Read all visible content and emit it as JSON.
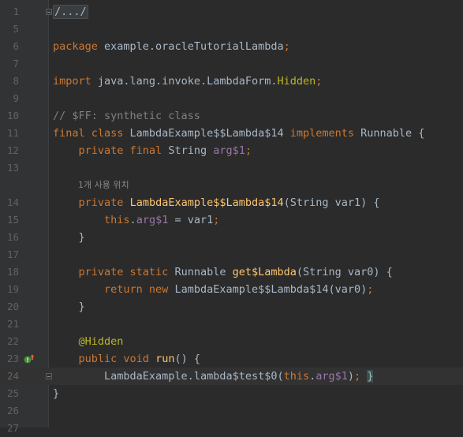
{
  "editor": {
    "lines": [
      {
        "n": "1",
        "tokens": [
          {
            "t": "/.../",
            "c": "folded-region"
          }
        ]
      },
      {
        "n": "5",
        "tokens": []
      },
      {
        "n": "6",
        "tokens": [
          {
            "t": "package",
            "c": "kw"
          },
          {
            "t": " example.oracleTutorialLambda",
            "c": ""
          },
          {
            "t": ";",
            "c": "kw"
          }
        ]
      },
      {
        "n": "7",
        "tokens": []
      },
      {
        "n": "8",
        "tokens": [
          {
            "t": "import",
            "c": "kw"
          },
          {
            "t": " java.lang.invoke.LambdaForm.",
            "c": ""
          },
          {
            "t": "Hidden",
            "c": "ann"
          },
          {
            "t": ";",
            "c": "kw"
          }
        ]
      },
      {
        "n": "9",
        "tokens": []
      },
      {
        "n": "10",
        "tokens": [
          {
            "t": "// $FF: synthetic class",
            "c": "cmt"
          }
        ]
      },
      {
        "n": "11",
        "tokens": [
          {
            "t": "final class",
            "c": "kw"
          },
          {
            "t": " LambdaExample$$Lambda$14 ",
            "c": ""
          },
          {
            "t": "implements",
            "c": "kw"
          },
          {
            "t": " Runnable {",
            "c": ""
          }
        ]
      },
      {
        "n": "12",
        "tokens": [
          {
            "t": "    ",
            "c": ""
          },
          {
            "t": "private final",
            "c": "kw"
          },
          {
            "t": " String ",
            "c": ""
          },
          {
            "t": "arg$1",
            "c": "fld"
          },
          {
            "t": ";",
            "c": "kw"
          }
        ]
      },
      {
        "n": "13",
        "tokens": []
      },
      {
        "n": "",
        "hint": "1개 사용 위치"
      },
      {
        "n": "14",
        "tokens": [
          {
            "t": "    ",
            "c": ""
          },
          {
            "t": "private",
            "c": "kw"
          },
          {
            "t": " ",
            "c": ""
          },
          {
            "t": "LambdaExample$$Lambda$14",
            "c": "meth"
          },
          {
            "t": "(String var1) {",
            "c": ""
          }
        ]
      },
      {
        "n": "15",
        "tokens": [
          {
            "t": "        ",
            "c": ""
          },
          {
            "t": "this",
            "c": "kw"
          },
          {
            "t": ".",
            "c": ""
          },
          {
            "t": "arg$1",
            "c": "fld"
          },
          {
            "t": " = var1",
            "c": ""
          },
          {
            "t": ";",
            "c": "kw"
          }
        ]
      },
      {
        "n": "16",
        "tokens": [
          {
            "t": "    }",
            "c": ""
          }
        ]
      },
      {
        "n": "17",
        "tokens": []
      },
      {
        "n": "18",
        "tokens": [
          {
            "t": "    ",
            "c": ""
          },
          {
            "t": "private static",
            "c": "kw"
          },
          {
            "t": " Runnable ",
            "c": ""
          },
          {
            "t": "get$Lambda",
            "c": "meth"
          },
          {
            "t": "(String var0) {",
            "c": ""
          }
        ]
      },
      {
        "n": "19",
        "tokens": [
          {
            "t": "        ",
            "c": ""
          },
          {
            "t": "return new",
            "c": "kw"
          },
          {
            "t": " LambdaExample$$Lambda$14(var0)",
            "c": ""
          },
          {
            "t": ";",
            "c": "kw"
          }
        ]
      },
      {
        "n": "20",
        "tokens": [
          {
            "t": "    }",
            "c": ""
          }
        ]
      },
      {
        "n": "21",
        "tokens": []
      },
      {
        "n": "22",
        "tokens": [
          {
            "t": "    ",
            "c": ""
          },
          {
            "t": "@Hidden",
            "c": "ann"
          }
        ]
      },
      {
        "n": "23",
        "icon": "implements-method-icon",
        "tokens": [
          {
            "t": "    ",
            "c": ""
          },
          {
            "t": "public void",
            "c": "kw"
          },
          {
            "t": " ",
            "c": ""
          },
          {
            "t": "run",
            "c": "meth"
          },
          {
            "t": "() {",
            "c": ""
          }
        ]
      },
      {
        "n": "24",
        "current": true,
        "tokens": [
          {
            "t": "        LambdaExample.",
            "c": ""
          },
          {
            "t": "lambda$test$0",
            "c": ""
          },
          {
            "t": "(",
            "c": ""
          },
          {
            "t": "this",
            "c": "kw"
          },
          {
            "t": ".",
            "c": ""
          },
          {
            "t": "arg$1",
            "c": "fld"
          },
          {
            "t": ")",
            "c": ""
          },
          {
            "t": ";",
            "c": "kw"
          },
          {
            "t": " ",
            "c": ""
          },
          {
            "t": "}",
            "c": "caret-brace"
          }
        ]
      },
      {
        "n": "25",
        "tokens": [
          {
            "t": "}",
            "c": ""
          }
        ]
      },
      {
        "n": "26",
        "tokens": []
      },
      {
        "n": "27",
        "tokens": []
      }
    ]
  },
  "colors": {
    "background": "#2b2b2b",
    "gutter": "#313335",
    "keyword": "#cc7832",
    "annotation": "#bbb529",
    "field": "#9876aa",
    "method": "#ffc66d",
    "comment": "#808080",
    "text": "#a9b7c6"
  }
}
